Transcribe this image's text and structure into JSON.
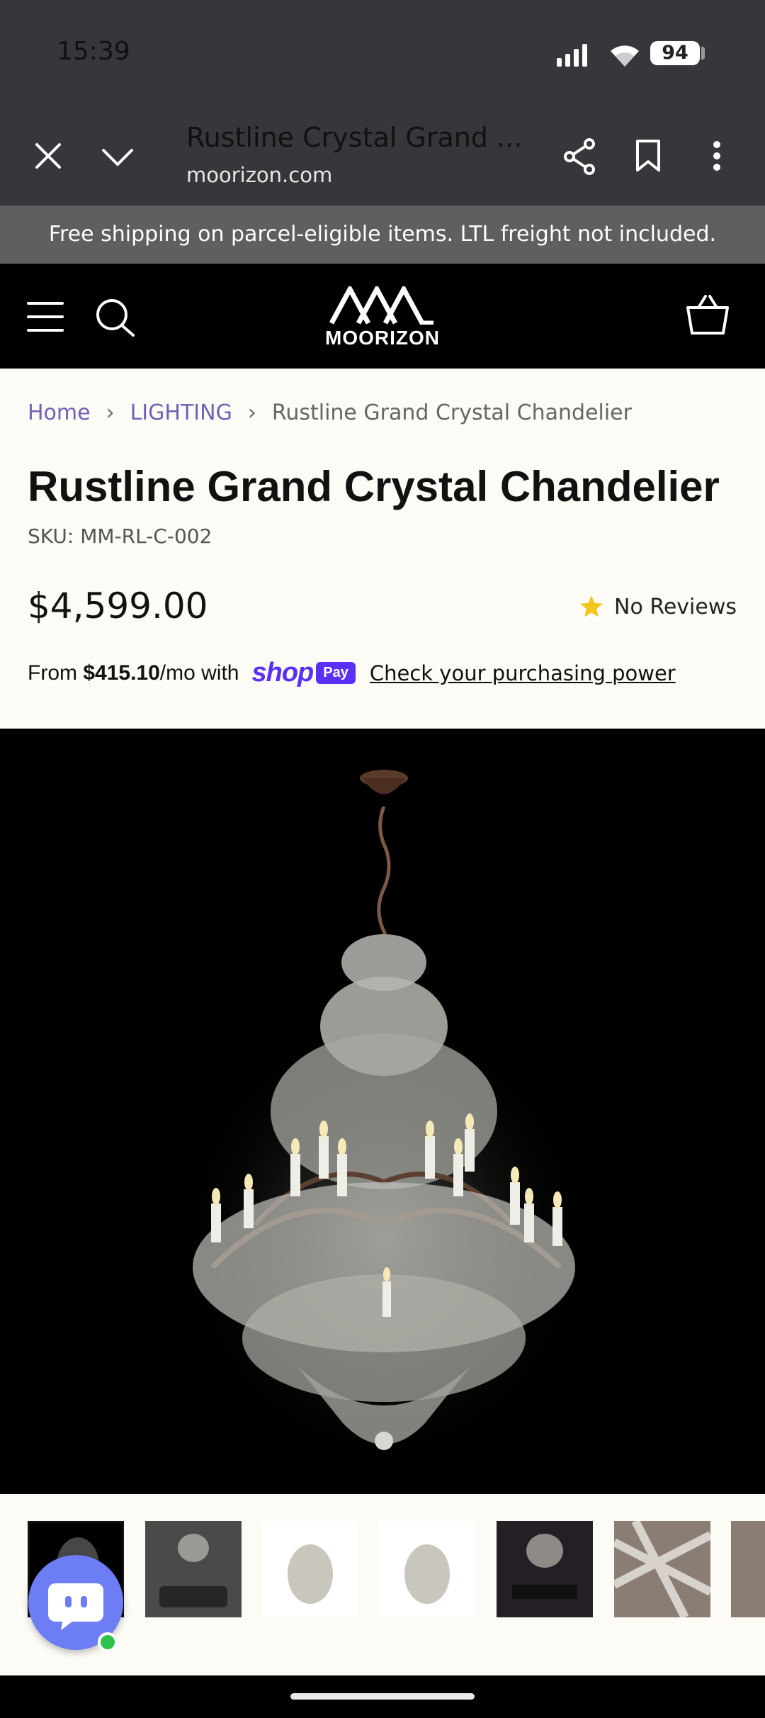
{
  "status_bar": {
    "time": "15:39",
    "battery": "94"
  },
  "browser": {
    "title": "Rustline Crystal Grand ...",
    "domain": "moorizon.com"
  },
  "promo_banner": "Free shipping on parcel-eligible items. LTL freight not included.",
  "site": {
    "logo": "MOORIZON"
  },
  "breadcrumb": {
    "home": "Home",
    "category": "LIGHTING",
    "current": "Rustline Grand Crystal Chandelier"
  },
  "product": {
    "title": "Rustline Grand Crystal Chandelier",
    "sku": "SKU: MM-RL-C-002",
    "price": "$4,599.00",
    "reviews": "No Reviews",
    "installment_prefix": "From ",
    "installment_amount": "$415.10",
    "installment_suffix": "/mo with",
    "shop_word": "shop",
    "pay_badge": "Pay",
    "purchasing_power_link": "Check your purchasing power"
  },
  "colors": {
    "accent": "#5a31f4",
    "link": "#7361b5",
    "star": "#f5c518",
    "chat": "#6d7ef5"
  },
  "icons": [
    "close-icon",
    "chevron-down-icon",
    "share-icon",
    "bookmark-icon",
    "more-vert-icon",
    "menu-icon",
    "search-icon",
    "cart-icon",
    "star-icon",
    "chat-icon",
    "signal-icon",
    "wifi-icon"
  ]
}
